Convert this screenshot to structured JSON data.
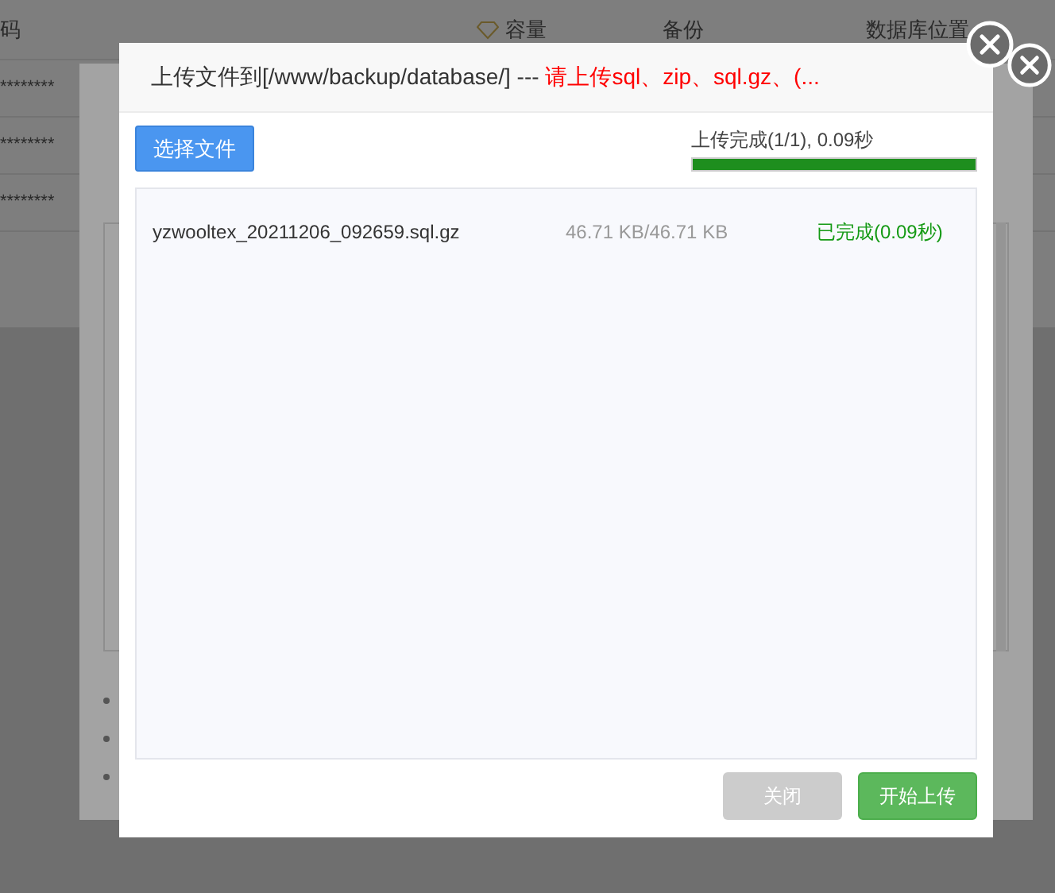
{
  "background_page": {
    "columns": [
      {
        "label": "码",
        "kind": "text"
      },
      {
        "label": "容量",
        "kind": "icon"
      },
      {
        "label": "备份",
        "kind": "text"
      },
      {
        "label": "数据库位置",
        "kind": "text"
      }
    ],
    "rows": [
      {
        "password": "********"
      },
      {
        "password": "********"
      },
      {
        "password": "********"
      }
    ]
  },
  "dialog": {
    "title": "上传文件到[/www/backup/database/] --- ",
    "title_hint": "请上传sql、zip、sql.gz、(...",
    "choose_button": "选择文件",
    "status": "上传完成(1/1), 0.09秒",
    "progress": {
      "level": 1
    },
    "files": [
      {
        "name": "yzwooltex_20211206_092659.sql.gz",
        "size": "46.71 KB/46.71 KB",
        "state": "已完成(0.09秒)",
        "done": true
      }
    ],
    "buttons": [
      {
        "label": "关闭",
        "kind": "secondary",
        "disabled": true
      },
      {
        "label": "开始上传",
        "kind": "primary",
        "disabled": false
      }
    ]
  }
}
